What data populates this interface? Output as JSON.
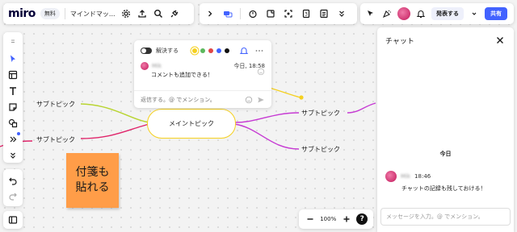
{
  "topbar": {
    "logo": "miro",
    "plan_badge": "無料",
    "board_name": "マインドマッ...",
    "present_label": "発表する",
    "share_label": "共有"
  },
  "comment": {
    "resolve_label": "解決する",
    "colors": [
      "#f5d020",
      "#5cb85c",
      "#e04646",
      "#4262ff",
      "#111111"
    ],
    "author": "Mik",
    "time": "今日, 18:58",
    "text": "コメントも追加できる！",
    "input_placeholder": "返信する。@ でメンション。"
  },
  "mindmap": {
    "central": "メイントピック",
    "left_topics": [
      "サブトピック",
      "サブトピック"
    ],
    "right_topics": [
      "サブトピック",
      "サブトピック"
    ]
  },
  "sticky": {
    "line1": "付箋も",
    "line2": "貼れる",
    "color": "#ff9d48"
  },
  "zoom": {
    "level": "100%",
    "help": "?"
  },
  "chat": {
    "title": "チャット",
    "day_label": "今日",
    "author": "Mik",
    "time": "18:46",
    "message": "チャットの記録も残しておける！",
    "input_placeholder": "メッセージを入力。@ でメンション。"
  },
  "icons": {
    "toolbar": [
      "grip-icon",
      "select-cursor-icon",
      "template-icon",
      "text-icon",
      "sticky-note-icon",
      "shapes-icon",
      "more-tools-icon",
      "chevron-down-icon"
    ]
  }
}
